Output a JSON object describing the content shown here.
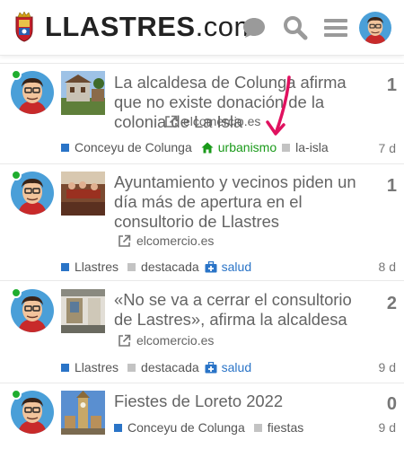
{
  "header": {
    "logo_main": "LLASTRES",
    "logo_suffix": ".com",
    "icons": [
      "chat-icon",
      "search-icon",
      "hamburger-menu-icon",
      "user-avatar"
    ]
  },
  "topics": [
    {
      "title": "La alcaldesa de Colunga afirma que no existe donación de la colonia de La Isla",
      "link": "elcomercio.es",
      "count": "1",
      "age": "7 d",
      "category": "Conceyu de Colunga",
      "tags": [
        {
          "label": "urbanismo",
          "icon": "home-icon",
          "color": "green"
        },
        {
          "label": "la-isla",
          "icon": "square",
          "color": "grey"
        }
      ]
    },
    {
      "title": "Ayuntamiento y vecinos piden un día más de apertura en el consultorio de Llastres",
      "link": "elcomercio.es",
      "count": "1",
      "age": "8 d",
      "category": "Llastres",
      "tags": [
        {
          "label": "destacada",
          "icon": "square",
          "color": "grey"
        },
        {
          "label": "salud",
          "icon": "medical-kit-icon",
          "color": "blue"
        }
      ]
    },
    {
      "title": "«No se va a cerrar el consultorio de Lastres», afirma la alcaldesa",
      "link": "elcomercio.es",
      "count": "2",
      "age": "9 d",
      "category": "Llastres",
      "tags": [
        {
          "label": "destacada",
          "icon": "square",
          "color": "grey"
        },
        {
          "label": "salud",
          "icon": "medical-kit-icon",
          "color": "blue"
        }
      ]
    },
    {
      "title": "Fiestes de Loreto 2022",
      "link": "",
      "count": "0",
      "age": "9 d",
      "category": "Conceyu de Colunga",
      "tags": [
        {
          "label": "fiestas",
          "icon": "square",
          "color": "grey"
        }
      ]
    }
  ],
  "colors": {
    "category": "#2a74c7",
    "online": "#1fad2f",
    "arrow": "#e0115f",
    "tag_green": "#1a9a1a"
  }
}
